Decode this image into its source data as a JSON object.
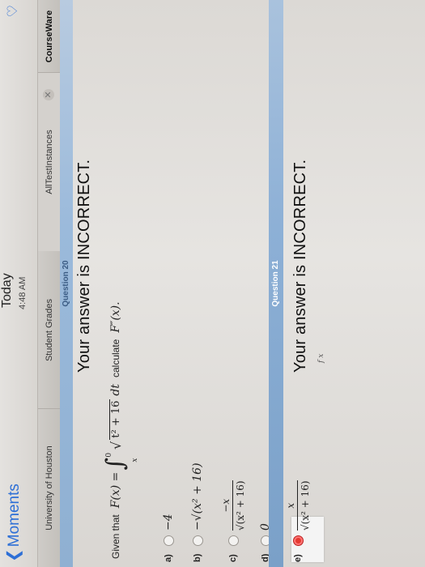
{
  "status_bar": {
    "back_label": "Moments",
    "today_label": "Today",
    "time": "4:48 AM"
  },
  "tabs": [
    {
      "label": "University of Houston"
    },
    {
      "label": "Student Grades"
    },
    {
      "label": "AllTestInstances"
    },
    {
      "label": "CourseWare"
    }
  ],
  "questions": [
    {
      "header": "Question 20",
      "result": "Your answer is INCORRECT."
    },
    {
      "header": "Question 21",
      "result": "Your answer is INCORRECT."
    }
  ],
  "question20": {
    "prompt_prefix": "Given that",
    "prompt_suffix": "calculate",
    "function": "F(x) =",
    "integral_upper": "0",
    "integral_lower": "x",
    "integrand": "t² + 16",
    "differential": "dt",
    "target": "F″(x).",
    "options": [
      {
        "letter": "a)",
        "value": "−4"
      },
      {
        "letter": "b)",
        "value": "−√(x² + 16)"
      },
      {
        "letter": "c)",
        "numerator": "−x",
        "denominator": "√(x² + 16)"
      },
      {
        "letter": "d)",
        "value": "0"
      },
      {
        "letter": "e)",
        "numerator": "x",
        "denominator": "√(x² + 16)",
        "selected": true
      }
    ]
  },
  "question21_preview": "f x",
  "colors": {
    "accent": "#2d6fd6",
    "selected_radio": "#e53a32",
    "question_header": "#9bbadb"
  }
}
